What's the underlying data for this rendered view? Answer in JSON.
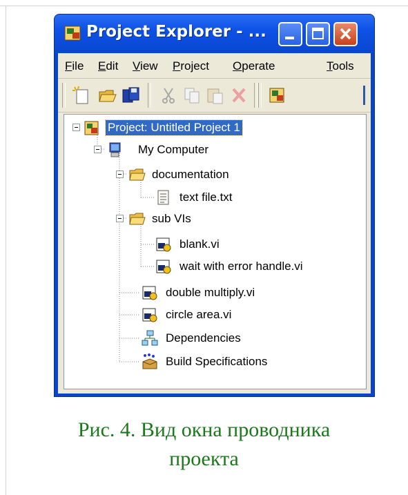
{
  "window": {
    "title": "Project Explorer - ...",
    "buttons": [
      "minimize",
      "maximize",
      "close"
    ]
  },
  "menu": [
    {
      "label": "File",
      "underline": "F",
      "rest": "ile"
    },
    {
      "label": "Edit",
      "underline": "E",
      "rest": "dit"
    },
    {
      "label": "View",
      "underline": "V",
      "rest": "iew"
    },
    {
      "label": "Project",
      "underline": "P",
      "rest": "roject"
    },
    {
      "label": "Operate",
      "underline": "O",
      "rest": "perate"
    },
    {
      "label": "Tools",
      "underline": "T",
      "rest": "ools"
    }
  ],
  "toolbar": [
    "new-icon",
    "open-folder-icon",
    "save-all-icon",
    "cut-icon",
    "copy-icon",
    "paste-icon",
    "delete-icon",
    "project-icon"
  ],
  "tree": [
    {
      "label": "Project: Untitled Project 1",
      "icon": "project-icon",
      "selected": true
    },
    {
      "label": "My Computer",
      "icon": "computer-icon"
    },
    {
      "label": "documentation",
      "icon": "folder-icon"
    },
    {
      "label": "text file.txt",
      "icon": "text-file-icon"
    },
    {
      "label": "sub VIs",
      "icon": "folder-icon"
    },
    {
      "label": "blank.vi",
      "icon": "vi-icon"
    },
    {
      "label": "wait with error handle.vi",
      "icon": "vi-icon"
    },
    {
      "label": "double multiply.vi",
      "icon": "vi-icon"
    },
    {
      "label": "circle area.vi",
      "icon": "vi-icon"
    },
    {
      "label": "Dependencies",
      "icon": "dependencies-icon"
    },
    {
      "label": "Build Specifications",
      "icon": "build-specifications-icon"
    }
  ],
  "caption": {
    "line1": "Рис. 4.  Вид окна проводника",
    "line2": "проекта"
  },
  "colors": {
    "title_bar": "#0a46cf",
    "selection": "#316ac5",
    "caption": "#1a7a1a",
    "client": "#ece9d8"
  }
}
